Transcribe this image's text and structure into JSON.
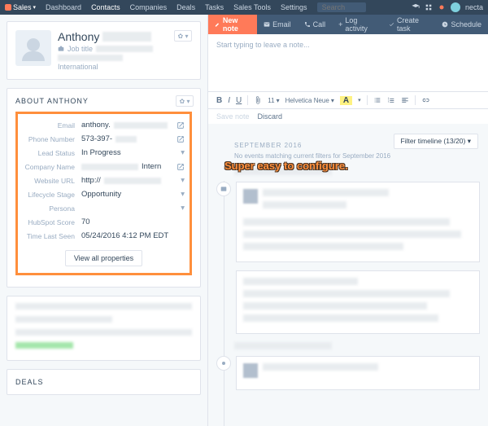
{
  "nav": {
    "brand": "Sales",
    "items": [
      "Dashboard",
      "Contacts",
      "Companies",
      "Deals",
      "Tasks",
      "Sales Tools",
      "Settings"
    ],
    "active_index": 1,
    "search_placeholder": "Search",
    "user": "necta"
  },
  "contact": {
    "first_name": "Anthony",
    "job_label": "Job title",
    "location": "International"
  },
  "about": {
    "title": "ABOUT ANTHONY",
    "rows": {
      "email": {
        "label": "Email",
        "value": "anthony."
      },
      "phone": {
        "label": "Phone Number",
        "value": "573-397-"
      },
      "lead_status": {
        "label": "Lead Status",
        "value": "In Progress"
      },
      "company": {
        "label": "Company Name",
        "value": "Intern"
      },
      "website": {
        "label": "Website URL",
        "value": "http://"
      },
      "lifecycle": {
        "label": "Lifecycle Stage",
        "value": "Opportunity"
      },
      "persona": {
        "label": "Persona",
        "value": ""
      },
      "score": {
        "label": "HubSpot Score",
        "value": "70"
      },
      "last_seen": {
        "label": "Time Last Seen",
        "value": "05/24/2016 4:12 PM EDT"
      }
    },
    "view_all": "View all properties"
  },
  "deals": {
    "title": "DEALS"
  },
  "activity": {
    "new_note": "New note",
    "email": "Email",
    "call": "Call",
    "log": "Log activity",
    "task": "Create task",
    "schedule": "Schedule",
    "note_placeholder": "Start typing to leave a note...",
    "font": "Helvetica Neue",
    "font_size": "11",
    "save": "Save note",
    "discard": "Discard"
  },
  "annotation": "Super easy to configure.",
  "timeline": {
    "filter": "Filter timeline (13/20)",
    "month": "SEPTEMBER 2016",
    "no_events": "No events matching current filters for September 2016"
  }
}
